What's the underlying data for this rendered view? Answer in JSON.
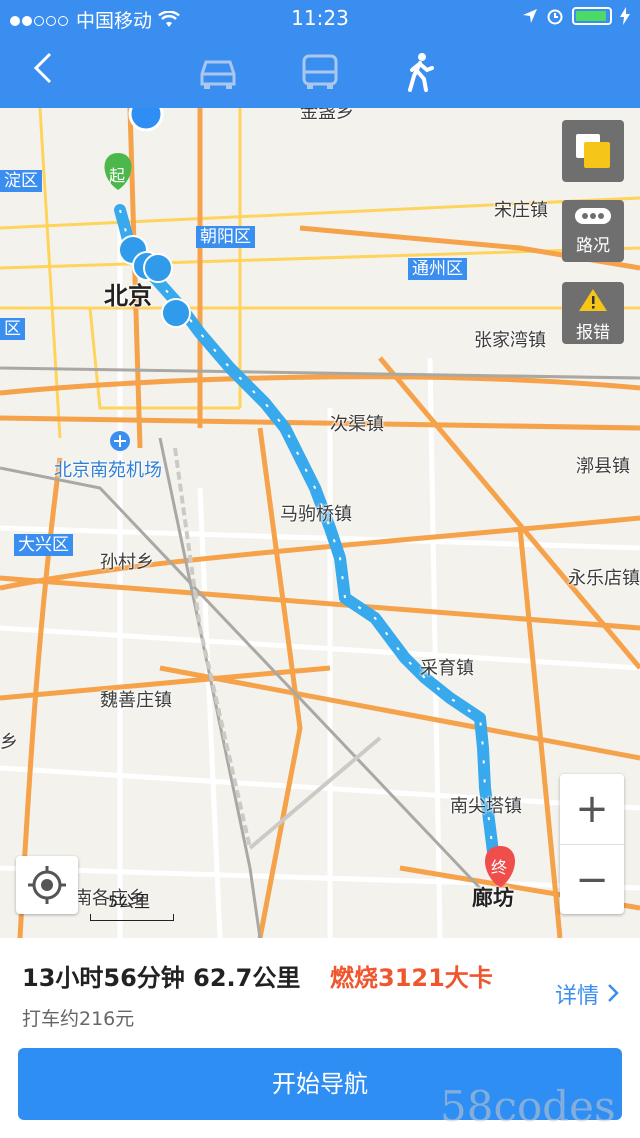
{
  "status_bar": {
    "carrier": "中国移动",
    "time": "11:23"
  },
  "nav": {
    "modes": [
      "car-icon",
      "bus-icon",
      "walk-icon"
    ],
    "active_mode": "walk-icon"
  },
  "map": {
    "labels": {
      "haidian": "淀区",
      "chaoyang": "朝阳区",
      "beijing": "北京",
      "songzhuang": "宋庄镇",
      "tongzhou": "通州区",
      "zhangjiawan": "张家湾镇",
      "ciqu": "次渠镇",
      "nanyuan": "北京南苑机场",
      "majuqiao": "马驹桥镇",
      "daxing": "大兴区",
      "suncun": "孙村乡",
      "lixian": "漷县镇",
      "yongledian": "永乐店镇",
      "caiyu": "采育镇",
      "weishanzhuang": "魏善庄镇",
      "nanjianta": "南尖塔镇",
      "langfang": "廊坊",
      "nangezhuang": "南各庄乡",
      "xiang_left": "乡",
      "qu_left": "区",
      "top_partial": "金盏乡"
    },
    "start_marker": "起",
    "end_marker": "终",
    "traffic_label": "路况",
    "report_label": "报错",
    "scale_label": "5公里",
    "zoom_in": "+",
    "zoom_out": "−"
  },
  "panel": {
    "summary": "13小时56分钟 62.7公里",
    "burn": "燃烧3121大卡",
    "taxi": "打车约216元",
    "detail": "详情",
    "navigate": "开始导航"
  },
  "watermark": "58codes",
  "colors": {
    "primary": "#3a8ef0",
    "route": "#38a9ec",
    "accent": "#f0562e"
  }
}
